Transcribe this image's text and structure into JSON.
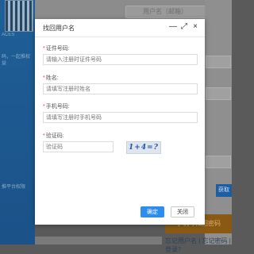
{
  "background": {
    "left_text_1": "ACES",
    "left_text_2": "码，一起推权益",
    "left_text_3": "推平台权限",
    "top_input_text": "用户名（邮箱）",
    "side_button": "获取",
    "orange_button": "手机号找回密码",
    "bottom_text": "忘记用户名 | 忘记密码 | 登录？"
  },
  "dialog": {
    "title": "找回用户名",
    "minimize_glyph": "—",
    "maximize_glyph": "⤢",
    "close_glyph": "×",
    "fields": {
      "id_number": {
        "label": "证件号码:",
        "placeholder": "请输入注册时证件号码"
      },
      "name": {
        "label": "姓名:",
        "placeholder": "请填写注册时姓名"
      },
      "phone": {
        "label": "手机号码:",
        "placeholder": "请填写注册时手机号码"
      },
      "captcha": {
        "label": "验证码:",
        "placeholder": "验证码",
        "image_text": "1+4=?"
      }
    },
    "confirm_label": "确定",
    "close_label": "关闭"
  }
}
